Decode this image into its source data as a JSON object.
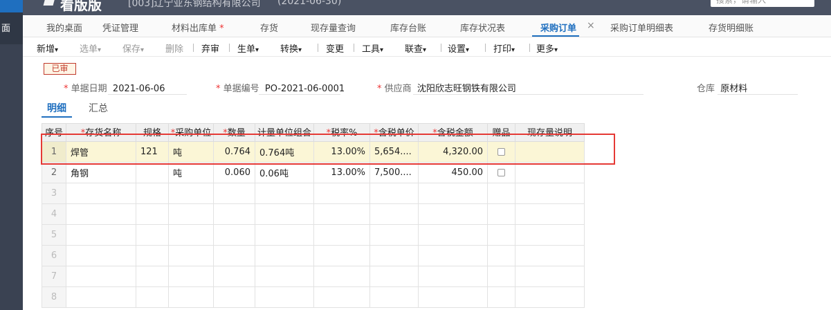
{
  "app": {
    "side_text": "面",
    "brand": "看版版",
    "company": "[003]辽宁亚东钢结构有限公司",
    "period": "(2021-06-30)",
    "search_placeholder": "搜索，请输入"
  },
  "tabs": [
    {
      "label": "我的桌面"
    },
    {
      "label": "凭证管理"
    },
    {
      "label": "材料出库单",
      "required_mark": "*"
    },
    {
      "label": "存货"
    },
    {
      "label": "现存量查询"
    },
    {
      "label": "库存台账"
    },
    {
      "label": "库存状况表"
    },
    {
      "label": "采购订单",
      "active": true,
      "close_icon": "×"
    },
    {
      "label": "采购订单明细表"
    },
    {
      "label": "存货明细账"
    }
  ],
  "toolbar": {
    "items": [
      "新增",
      "选单",
      "保存",
      "删除",
      "弃审",
      "生单",
      "转换",
      "变更",
      "工具",
      "联查",
      "设置",
      "打印",
      "更多"
    ],
    "caret": "▾"
  },
  "status": {
    "label": "已审",
    "color": "#c0392b"
  },
  "header": {
    "required_mark": "*",
    "date_label": "单据日期",
    "date_value": "2021-06-06",
    "code_label": "单据编号",
    "code_value": "PO-2021-06-0001",
    "supplier_label": "供应商",
    "supplier_value": "沈阳欣志旺钢铁有限公司",
    "warehouse_label": "仓库",
    "warehouse_value": "原材料"
  },
  "subtabs": {
    "detail": "明细",
    "summary": "汇总"
  },
  "grid": {
    "columns": [
      "序号",
      "存货名称",
      "规格",
      "采购单位",
      "数量",
      "计量单位组合",
      "税率%",
      "含税单价",
      "含税金额",
      "赠品",
      "现存量说明"
    ],
    "rows": [
      {
        "no": "1",
        "name": "焊管",
        "spec": "121",
        "unit": "吨",
        "qty": "0.764",
        "unit_combo": "0.764吨",
        "tax": "13.00%",
        "price": "5,654....",
        "amount": "4,320.00"
      },
      {
        "no": "2",
        "name": "角钢",
        "spec": "",
        "unit": "吨",
        "qty": "0.060",
        "unit_combo": "0.06吨",
        "tax": "13.00%",
        "price": "7,500....",
        "amount": "450.00"
      }
    ],
    "empty_rows": [
      "3",
      "4",
      "5",
      "6",
      "7",
      "8"
    ]
  },
  "colors": {
    "accent": "#1f6fbf",
    "highlight": "#e53935",
    "selected_row": "#fbf6d6"
  }
}
